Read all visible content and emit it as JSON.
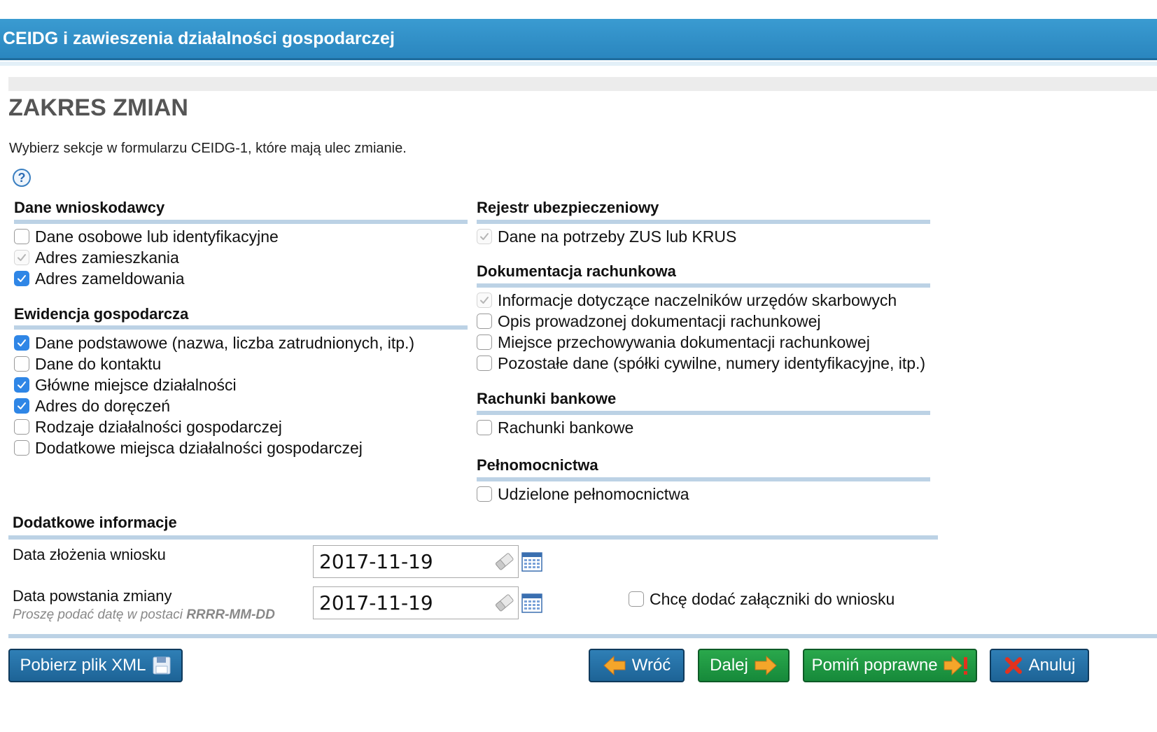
{
  "window": {
    "title": "CEIDG i zawieszenia działalności gospodarczej"
  },
  "page": {
    "title": "ZAKRES ZMIAN",
    "intro": "Wybierz sekcje w formularzu CEIDG-1, które mają ulec zmianie.",
    "help_icon": "help-icon"
  },
  "left": {
    "applicant": {
      "header": "Dane wnioskodawcy",
      "items": [
        {
          "label": "Dane osobowe lub identyfikacyjne",
          "state": "unchecked"
        },
        {
          "label": "Adres zamieszkania",
          "state": "checked-disabled"
        },
        {
          "label": "Adres zameldowania",
          "state": "checked"
        }
      ]
    },
    "business": {
      "header": "Ewidencja gospodarcza",
      "items": [
        {
          "label": "Dane podstawowe (nazwa, liczba zatrudnionych, itp.)",
          "state": "checked"
        },
        {
          "label": "Dane do kontaktu",
          "state": "unchecked"
        },
        {
          "label": "Główne miejsce działalności",
          "state": "checked"
        },
        {
          "label": "Adres do doręczeń",
          "state": "checked"
        },
        {
          "label": "Rodzaje działalności gospodarczej",
          "state": "unchecked"
        },
        {
          "label": "Dodatkowe miejsca działalności gospodarczej",
          "state": "unchecked"
        }
      ]
    }
  },
  "right": {
    "insurance": {
      "header": "Rejestr ubezpieczeniowy",
      "items": [
        {
          "label": "Dane na potrzeby ZUS lub KRUS",
          "state": "checked-disabled"
        }
      ]
    },
    "accounting": {
      "header": "Dokumentacja rachunkowa",
      "items": [
        {
          "label": "Informacje dotyczące naczelników urzędów skarbowych",
          "state": "checked-disabled"
        },
        {
          "label": "Opis prowadzonej dokumentacji rachunkowej",
          "state": "unchecked"
        },
        {
          "label": "Miejsce przechowywania dokumentacji rachunkowej",
          "state": "unchecked"
        },
        {
          "label": "Pozostałe dane (spółki cywilne, numery identyfikacyjne, itp.)",
          "state": "unchecked"
        }
      ]
    },
    "bank": {
      "header": "Rachunki bankowe",
      "items": [
        {
          "label": "Rachunki bankowe",
          "state": "unchecked"
        }
      ]
    },
    "poa": {
      "header": "Pełnomocnictwa",
      "items": [
        {
          "label": "Udzielone pełnomocnictwa",
          "state": "unchecked"
        }
      ]
    }
  },
  "additional": {
    "header": "Dodatkowe informacje",
    "submission_date": {
      "label": "Data złożenia wniosku",
      "value": "2017-11-19"
    },
    "change_date": {
      "label": "Data powstania zmiany",
      "value": "2017-11-19",
      "hint_prefix": "Proszę podać datę w postaci ",
      "hint_format": "RRRR-MM-DD"
    },
    "attachments": {
      "label": "Chcę dodać załączniki do wniosku",
      "state": "unchecked"
    }
  },
  "buttons": {
    "download_xml": "Pobierz plik XML",
    "back": "Wróć",
    "next": "Dalej",
    "skip_valid": "Pomiń poprawne",
    "cancel": "Anuluj"
  },
  "colors": {
    "titlebar": "#2a86bf",
    "section_line": "#bcd2e5",
    "checkbox_checked": "#2f86e6",
    "button_blue": "#1d6396",
    "button_green": "#16893a"
  }
}
